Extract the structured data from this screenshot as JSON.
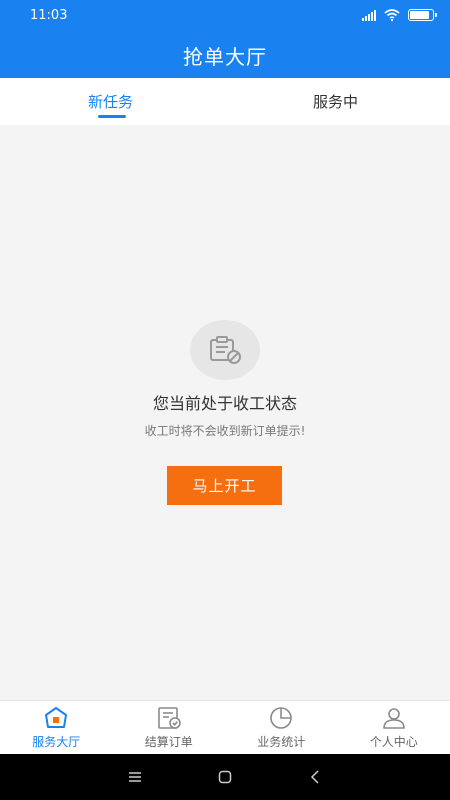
{
  "status_bar": {
    "time": "11:03"
  },
  "header": {
    "title": "抢单大厅"
  },
  "tabs": [
    {
      "label": "新任务",
      "active": true
    },
    {
      "label": "服务中",
      "active": false
    }
  ],
  "empty_state": {
    "title": "您当前处于收工状态",
    "subtitle": "收工时将不会收到新订单提示!",
    "button_label": "马上开工",
    "icon": "clipboard-off-icon"
  },
  "bottom_nav": [
    {
      "label": "服务大厅",
      "icon": "home-icon",
      "active": true
    },
    {
      "label": "结算订单",
      "icon": "order-check-icon",
      "active": false
    },
    {
      "label": "业务统计",
      "icon": "pie-chart-icon",
      "active": false
    },
    {
      "label": "个人中心",
      "icon": "user-icon",
      "active": false
    }
  ],
  "colors": {
    "primary": "#1a82f0",
    "accent": "#f56f10",
    "background": "#f4f4f4"
  }
}
